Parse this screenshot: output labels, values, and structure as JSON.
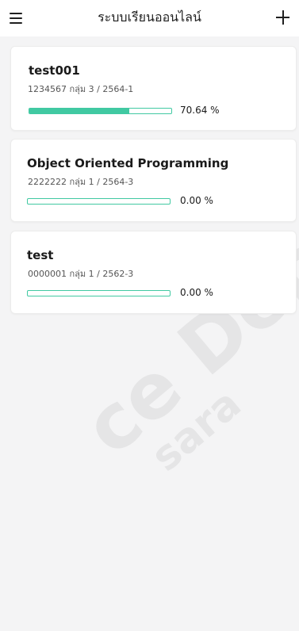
{
  "header": {
    "title": "ระบบเรียนออนไลน์",
    "menu_icon": "hamburger-menu-icon",
    "add_icon": "plus-icon"
  },
  "courses": [
    {
      "title": "test001",
      "meta": "1234567 กลุ่ม 3 / 2564-1",
      "progress": 70.64,
      "progress_label": "70.64 %"
    },
    {
      "title": "Object Oriented Programming",
      "meta": "2222222 กลุ่ม 1 / 2564-3",
      "progress": 0,
      "progress_label": "0.00 %"
    },
    {
      "title": "test",
      "meta": "0000001 กลุ่ม 1 / 2562-3",
      "progress": 0,
      "progress_label": "0.00 %"
    }
  ],
  "colors": {
    "progress": "#41c9a2",
    "background": "#f4f4f5",
    "card": "#ffffff"
  }
}
